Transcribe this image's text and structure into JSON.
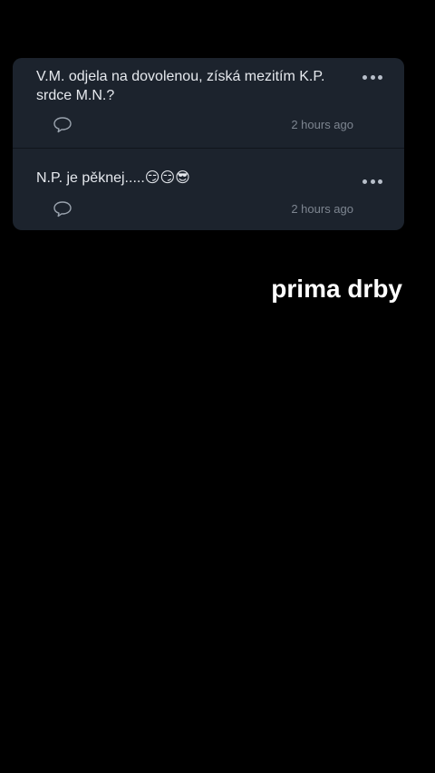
{
  "posts": [
    {
      "text": "V.M. odjela na dovolenou, získá mezitím K.P. srdce M.N.?",
      "timestamp": "2 hours ago",
      "more_icon": "ellipsis-icon",
      "comment_icon": "comment-bubble-icon"
    },
    {
      "text": "N.P. je pěknej.....😏😏😎",
      "timestamp": "2 hours ago",
      "more_icon": "ellipsis-icon",
      "comment_icon": "comment-bubble-icon"
    }
  ],
  "caption": "prima drby",
  "colors": {
    "background": "#000000",
    "card": "#1c232d",
    "text": "#e6e9ee",
    "muted": "#7d8590",
    "caption": "#ffffff"
  }
}
